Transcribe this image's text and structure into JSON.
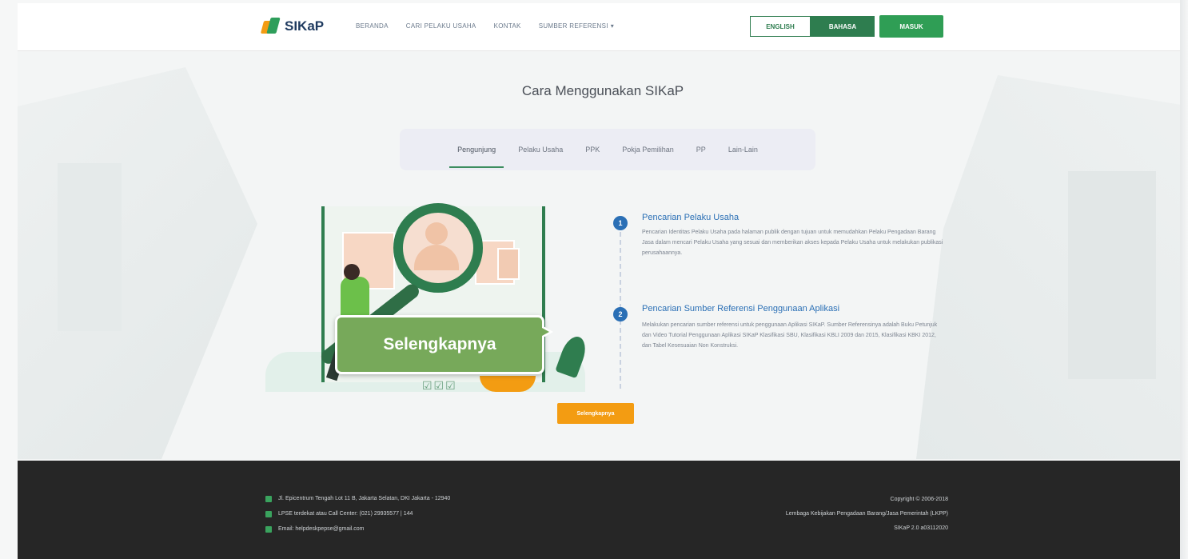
{
  "brand": {
    "name": "SIKaP"
  },
  "nav": {
    "links": [
      "BERANDA",
      "CARI PELAKU USAHA",
      "KONTAK",
      "SUMBER REFERENSI"
    ],
    "dropdown_caret": "▾",
    "lang_english": "ENGLISH",
    "lang_bahasa": "BAHASA",
    "login": "MASUK"
  },
  "page": {
    "title": "Cara Menggunakan SIKaP",
    "tabs": [
      "Pengunjung",
      "Pelaku Usaha",
      "PPK",
      "Pokja Pemilihan",
      "PP",
      "Lain-Lain"
    ],
    "active_tab": "Pengunjung"
  },
  "illustration": {
    "checks": "☑☑☑"
  },
  "callout": {
    "text": "Selengkapnya"
  },
  "steps": [
    {
      "num": "1",
      "title": "Pencarian Pelaku Usaha",
      "desc": "Pencarian Identitas Pelaku Usaha pada halaman publik dengan tujuan untuk memudahkan Pelaku Pengadaan Barang Jasa dalam mencari Pelaku Usaha yang sesuai dan memberikan akses kepada Pelaku Usaha untuk melakukan publikasi perusahaannya."
    },
    {
      "num": "2",
      "title": "Pencarian Sumber Referensi Penggunaan Aplikasi",
      "desc": "Melakukan pencarian sumber referensi untuk penggunaan Aplikasi SIKaP. Sumber Referensinya adalah Buku Petunjuk dan Video Tutorial Penggunaan Aplikasi SIKaP Klasifikasi SBU, Klasifikasi KBLI 2009 dan 2015, Klasifikasi KBKI 2012, dan Tabel Kesesuaian Non Konstruksi."
    }
  ],
  "more_button": "Selengkapnya",
  "footer": {
    "address": "Jl. Epicentrum Tengah Lot 11 B, Jakarta Selatan, DKI Jakarta - 12940",
    "callcenter": "LPSE terdekat atau Call Center: (021) 29935577 | 144",
    "email": "Email: helpdeskpepse@gmail.com",
    "copyright": "Copyright © 2006-2018",
    "org": "Lembaga Kebijakan Pengadaan Barang/Jasa Pemerintah (LKPP)",
    "version": "SIKaP 2.0 a03112020"
  },
  "colors": {
    "primary_green": "#2e7d4f",
    "accent_orange": "#f39c12",
    "step_blue": "#2a6fb5",
    "callout_green": "#77a95a",
    "footer_bg": "#262626"
  }
}
